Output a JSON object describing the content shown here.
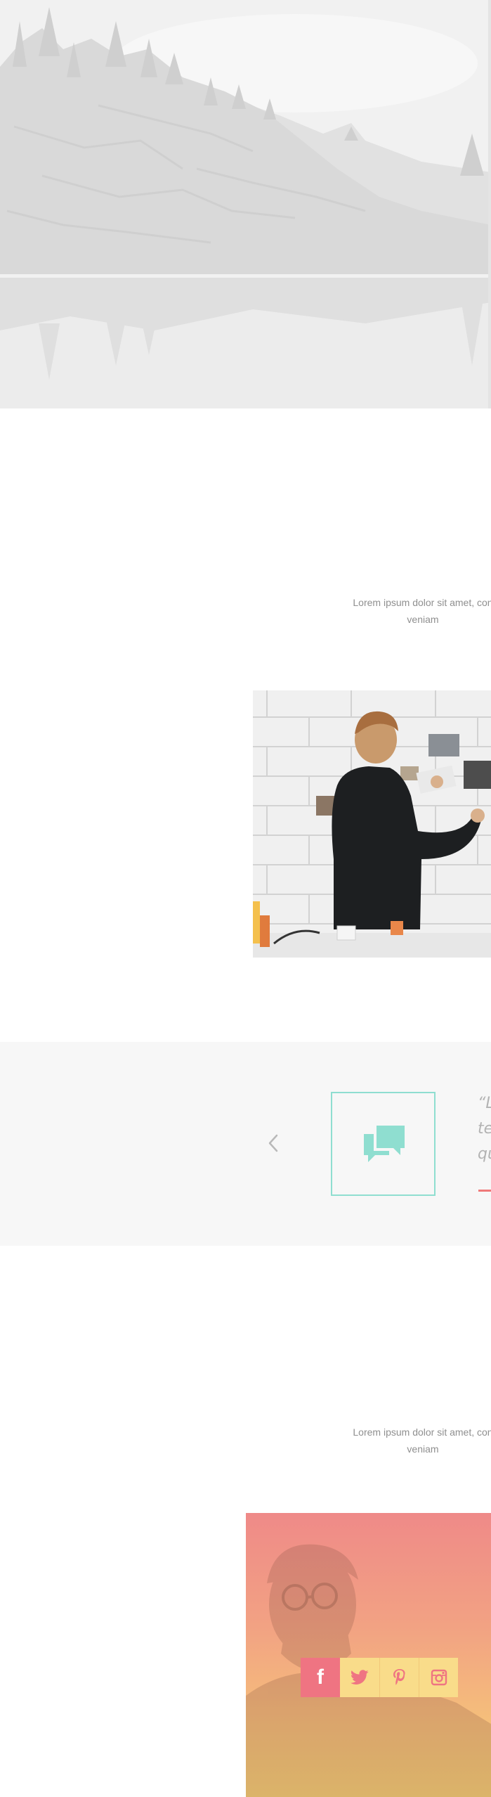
{
  "hero": {
    "image": "misty-lake-forest-photo"
  },
  "intro_top": {
    "text_line1": "Lorem ipsum dolor sit amet, con",
    "text_line2": "veniam"
  },
  "feature_photo": {
    "image": "man-pinning-photos-on-tile-wall"
  },
  "testimonial": {
    "icon": "chat-bubbles-icon",
    "quote_line1": "“L",
    "quote_line2": "te",
    "quote_line3": "qu",
    "accent_color": "#8fded0",
    "rule_color": "#ef7a7a"
  },
  "intro_bottom": {
    "text_line1": "Lorem ipsum dolor sit amet, con",
    "text_line2": "veniam"
  },
  "profile": {
    "image": "bearded-man-with-glasses-portrait",
    "social": [
      {
        "name": "facebook",
        "icon": "facebook-icon",
        "glyph": "f"
      },
      {
        "name": "twitter",
        "icon": "twitter-icon"
      },
      {
        "name": "pinterest",
        "icon": "pinterest-icon"
      },
      {
        "name": "instagram",
        "icon": "instagram-icon"
      }
    ],
    "social_active_color": "#ef7482",
    "social_color": "#f9dc8a"
  }
}
